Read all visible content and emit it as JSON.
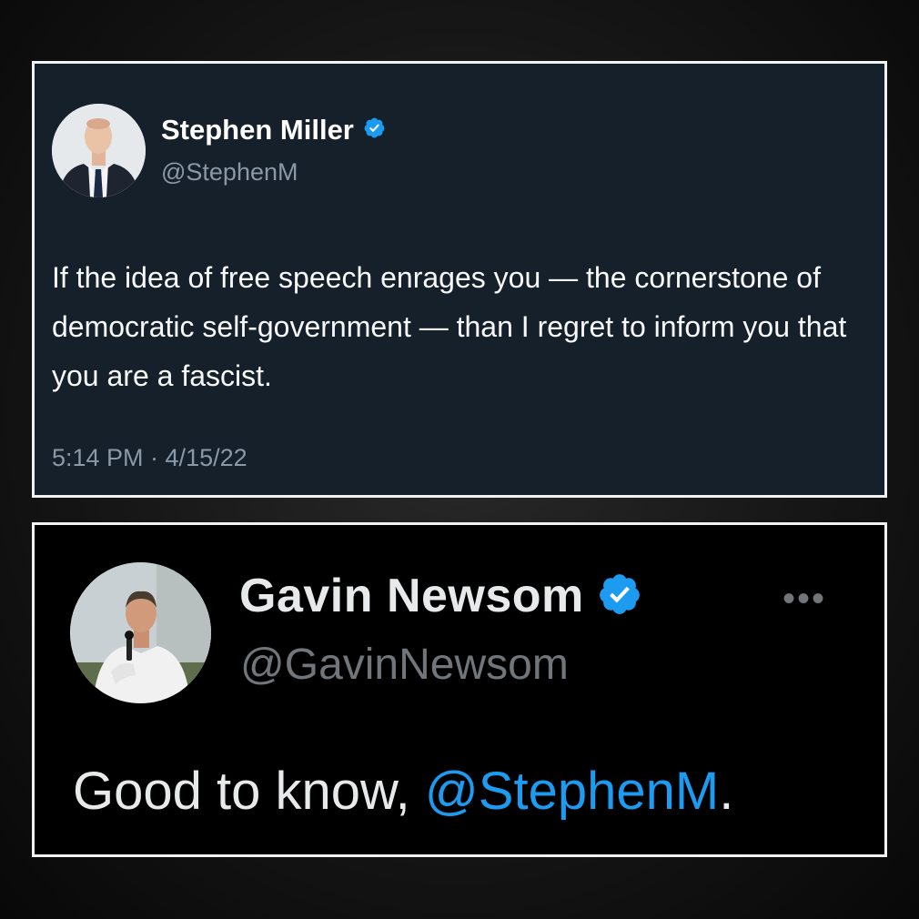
{
  "tweets": [
    {
      "display_name": "Stephen Miller",
      "handle": "@StephenM",
      "verified_icon": "verified-badge-icon",
      "text": "If the idea of free speech enrages you — the cornerstone of democratic self-government — than I regret to inform you that you are a fascist.",
      "timestamp": "5:14 PM · 4/15/22"
    },
    {
      "display_name": "Gavin Newsom",
      "handle": "@GavinNewsom",
      "verified_icon": "verified-badge-icon",
      "more_icon": "more-options-icon",
      "more_label": "•••",
      "text_prefix": "Good to know, ",
      "mention": "@StephenM",
      "text_suffix": "."
    }
  ],
  "colors": {
    "card1_bg": "#15202b",
    "card2_bg": "#000000",
    "verified_blue": "#1d9bf0",
    "mention_blue": "#1d9bf0"
  }
}
